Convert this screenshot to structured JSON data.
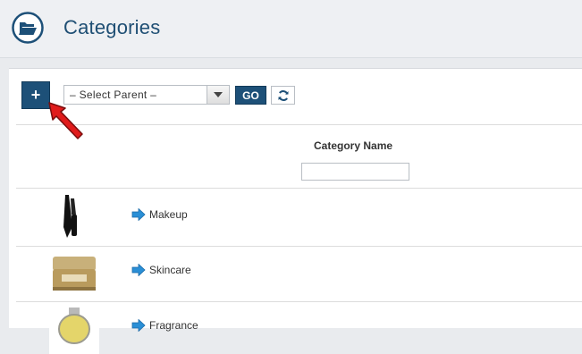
{
  "header": {
    "title": "Categories"
  },
  "toolbar": {
    "add_label": "+",
    "parent_select": "– Select Parent –",
    "go_label": "GO"
  },
  "table": {
    "column_header": "Category Name",
    "rows": [
      {
        "label": "Makeup"
      },
      {
        "label": "Skincare"
      },
      {
        "label": "Fragrance"
      }
    ]
  },
  "colors": {
    "accent": "#1d5078",
    "title": "#1f4f74",
    "link_arrow": "#2a8fd6",
    "annotation": "#e01b1b"
  }
}
